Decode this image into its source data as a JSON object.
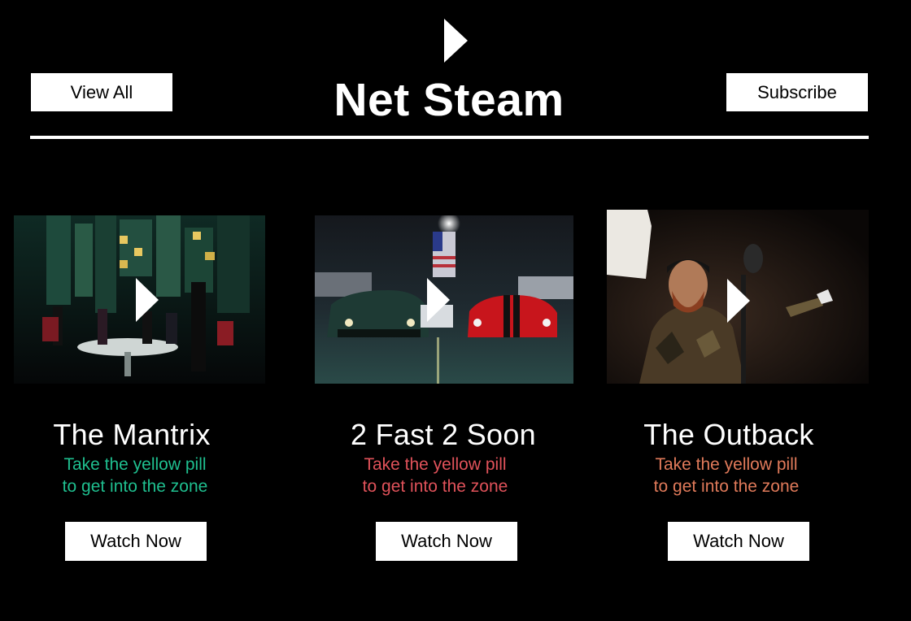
{
  "header": {
    "title": "Net Steam",
    "view_all_label": "View All",
    "subscribe_label": "Subscribe",
    "logo_icon": "play-icon"
  },
  "cards": [
    {
      "title": "The Mantrix",
      "description_line1": "Take the yellow pill",
      "description_line2": "to get into the zone",
      "description_color": "#1fbf8f",
      "button_label": "Watch Now",
      "thumbnail_icon": "play-icon"
    },
    {
      "title": "2 Fast 2 Soon",
      "description_line1": "Take the yellow pill",
      "description_line2": "to get into the zone",
      "description_color": "#e0525a",
      "button_label": "Watch Now",
      "thumbnail_icon": "play-icon"
    },
    {
      "title": "The Outback",
      "description_line1": "Take the yellow pill",
      "description_line2": "to get into the zone",
      "description_color": "#e07a5a",
      "button_label": "Watch Now",
      "thumbnail_icon": "play-icon"
    }
  ]
}
